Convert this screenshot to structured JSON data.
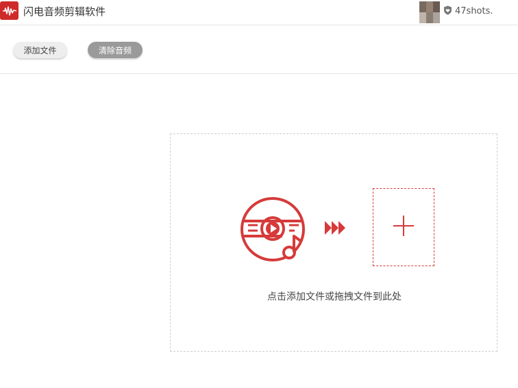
{
  "app": {
    "title": "闪电音频剪辑软件",
    "accent_color": "#cf2a2a"
  },
  "user": {
    "name": "47shots.",
    "badge_icon": "shield-heart-icon"
  },
  "toolbar": {
    "add_file_label": "添加文件",
    "clear_audio_label": "清除音频"
  },
  "dropzone": {
    "hint": "点击添加文件或拖拽文件到此处",
    "media_icon": "music-video-disc-icon",
    "arrow_icon": "triple-arrow-right-icon",
    "add_icon": "plus-icon"
  }
}
